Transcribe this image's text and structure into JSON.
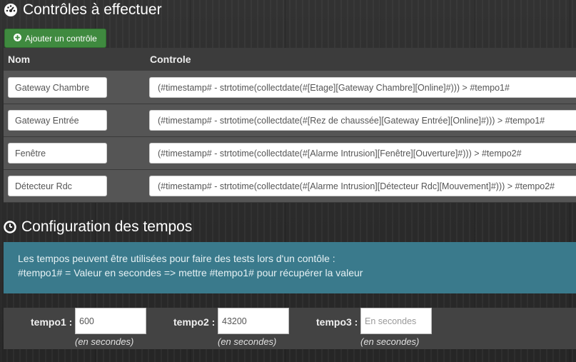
{
  "controles": {
    "title": "Contrôles à effectuer",
    "add_button_label": "Ajouter un contrôle",
    "columns": [
      "Nom",
      "Controle"
    ],
    "rows": [
      {
        "nom": "Gateway Chambre",
        "controle": "(#timestamp# - strtotime(collectdate(#[Etage][Gateway Chambre][Online]#))) > #tempo1#"
      },
      {
        "nom": "Gateway Entrée",
        "controle": "(#timestamp# - strtotime(collectdate(#[Rez de chaussée][Gateway Entrée][Online]#))) > #tempo1#"
      },
      {
        "nom": "Fenêtre",
        "controle": "(#timestamp# - strtotime(collectdate(#[Alarme Intrusion][Fenêtre][Ouverture]#))) > #tempo2#"
      },
      {
        "nom": "Détecteur Rdc",
        "controle": "(#timestamp# - strtotime(collectdate(#[Alarme Intrusion][Détecteur Rdc][Mouvement]#))) > #tempo2#"
      }
    ]
  },
  "tempos": {
    "title": "Configuration des tempos",
    "info_line1": "Les tempos peuvent être utilisées pour faire des tests lors d'un contôle :",
    "info_line2": "#tempo1# = Valeur en secondes => mettre #tempo1# pour récupérer la valeur",
    "fields": [
      {
        "label": "tempo1 :",
        "value": "600",
        "placeholder": "",
        "help": "(en secondes)"
      },
      {
        "label": "tempo2 :",
        "value": "43200",
        "placeholder": "",
        "help": "(en secondes)"
      },
      {
        "label": "tempo3 :",
        "value": "",
        "placeholder": "En secondes",
        "help": "(en secondes)"
      }
    ]
  },
  "colors": {
    "add_button": "#3f8a3f",
    "info_box": "#3a7a8c",
    "row_bg": "#555555"
  },
  "icons": {
    "title1": "dashboard-icon",
    "title2": "clock-icon",
    "add": "plus-circle-icon"
  }
}
